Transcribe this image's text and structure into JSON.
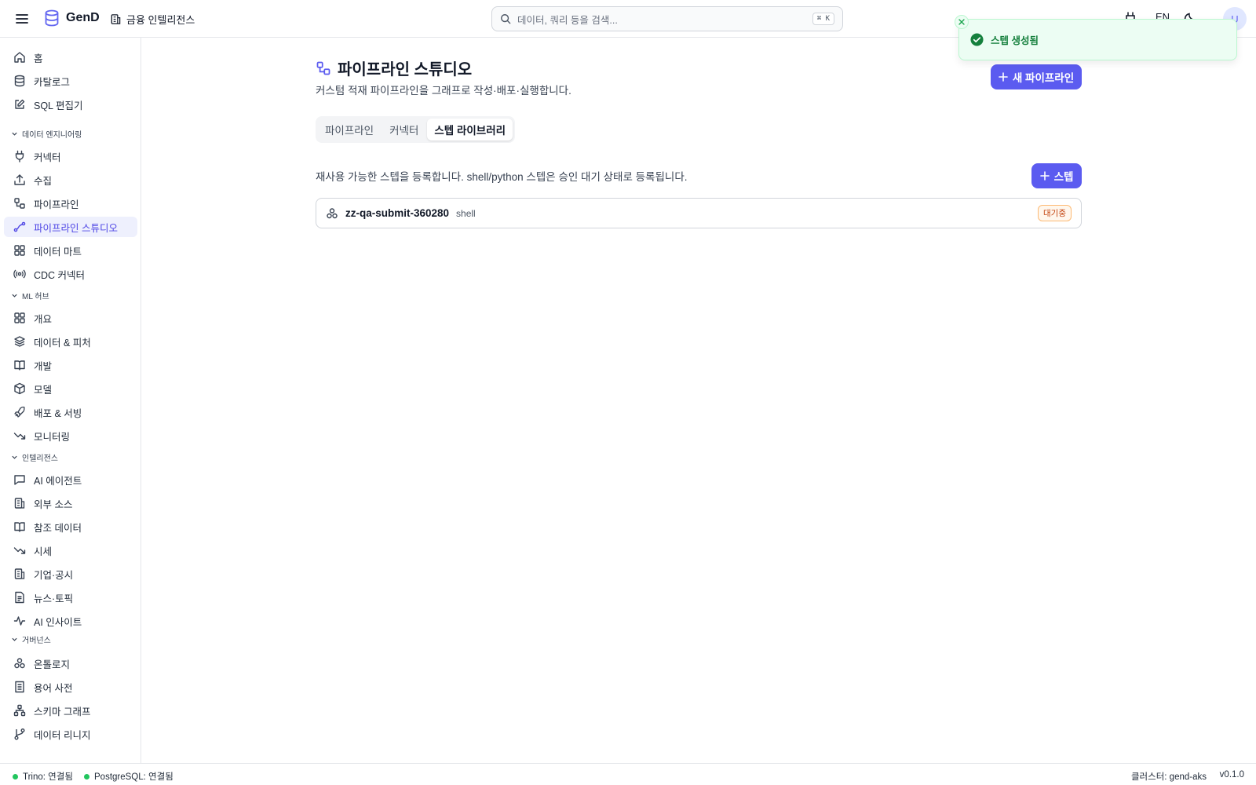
{
  "header": {
    "app_name": "GenD",
    "org_name": "금융 인텔리전스",
    "search_placeholder": "데이터, 쿼리 등을 검색...",
    "search_shortcut": "⌘ K",
    "language": "EN",
    "avatar_initial": "U",
    "brand_color": "#5b5bf0"
  },
  "sidebar": {
    "top_items": [
      {
        "label": "홈",
        "icon": "home-icon"
      },
      {
        "label": "카탈로그",
        "icon": "database-icon"
      },
      {
        "label": "SQL 편집기",
        "icon": "edit-icon"
      }
    ],
    "sections": [
      {
        "title": "데이터 엔지니어링",
        "items": [
          {
            "label": "커넥터",
            "icon": "plug-icon"
          },
          {
            "label": "수집",
            "icon": "upload-icon"
          },
          {
            "label": "파이프라인",
            "icon": "workflow-icon"
          },
          {
            "label": "파이프라인 스튜디오",
            "icon": "spline-icon",
            "active": true
          },
          {
            "label": "데이터 마트",
            "icon": "grid-icon"
          },
          {
            "label": "CDC 커넥터",
            "icon": "radio-icon"
          }
        ]
      },
      {
        "title": "ML 허브",
        "items": [
          {
            "label": "개요",
            "icon": "grid-icon"
          },
          {
            "label": "데이터 & 피처",
            "icon": "layers-icon"
          },
          {
            "label": "개발",
            "icon": "book-icon"
          },
          {
            "label": "모델",
            "icon": "box-icon"
          },
          {
            "label": "배포 & 서빙",
            "icon": "rocket-icon"
          },
          {
            "label": "모니터링",
            "icon": "trending-down-icon"
          }
        ]
      },
      {
        "title": "인텔리전스",
        "items": [
          {
            "label": "AI 에이전트",
            "icon": "chat-icon"
          },
          {
            "label": "외부 소스",
            "icon": "building-icon"
          },
          {
            "label": "참조 데이터",
            "icon": "book-icon"
          },
          {
            "label": "시세",
            "icon": "trending-down-icon"
          },
          {
            "label": "기업·공시",
            "icon": "building-icon"
          },
          {
            "label": "뉴스·토픽",
            "icon": "file-icon"
          },
          {
            "label": "AI 인사이트",
            "icon": "activity-icon"
          }
        ]
      },
      {
        "title": "거버넌스",
        "items": [
          {
            "label": "온톨로지",
            "icon": "boxes-icon"
          },
          {
            "label": "용어 사전",
            "icon": "file-icon"
          },
          {
            "label": "스키마 그래프",
            "icon": "network-icon"
          },
          {
            "label": "데이터 리니지",
            "icon": "git-branch-icon"
          }
        ]
      }
    ]
  },
  "page": {
    "title": "파이프라인 스튜디오",
    "description": "커스텀 적재 파이프라인을 그래프로 작성·배포·실행합니다.",
    "new_pipeline_button": "새 파이프라인",
    "tabs": [
      {
        "label": "파이프라인",
        "active": false
      },
      {
        "label": "커넥터",
        "active": false
      },
      {
        "label": "스텝 라이브러리",
        "active": true
      }
    ],
    "library_description": "재사용 가능한 스텝을 등록합니다. shell/python 스텝은 승인 대기 상태로 등록됩니다.",
    "add_step_button": "스텝",
    "steps": [
      {
        "name": "zz-qa-submit-360280",
        "type": "shell",
        "status": "대기중"
      }
    ]
  },
  "toast": {
    "message": "스텝 생성됨",
    "color": "#15803d"
  },
  "statusbar": {
    "trino": "Trino: 연결됨",
    "postgres": "PostgreSQL: 연결됨",
    "cluster": "클러스터: gend-aks",
    "version": "v0.1.0"
  }
}
